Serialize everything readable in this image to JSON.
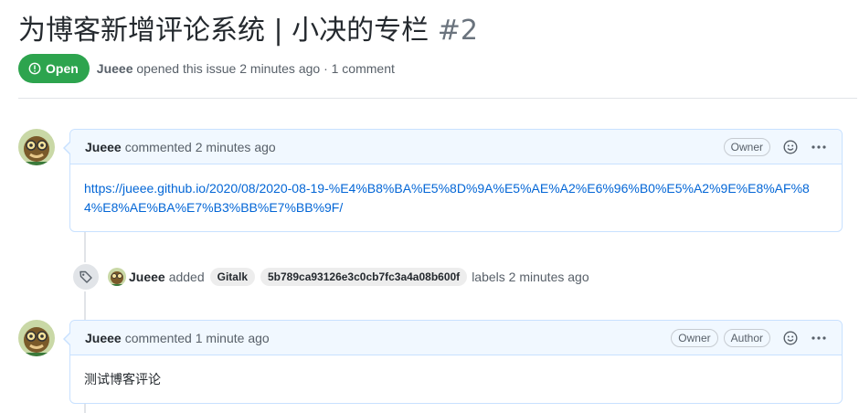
{
  "issue": {
    "title": "为博客新增评论系统 | 小决的专栏",
    "number": "#2",
    "state": "Open",
    "author": "Jueee",
    "meta": "opened this issue 2 minutes ago · 1 comment"
  },
  "comments": [
    {
      "author": "Jueee",
      "action": "commented 2 minutes ago",
      "roles": [
        "Owner"
      ],
      "body": "https://jueee.github.io/2020/08/2020-08-19-%E4%B8%BA%E5%8D%9A%E5%AE%A2%E6%96%B0%E5%A2%9E%E8%AF%84%E8%AE%BA%E7%B3%BB%E7%BB%9F/"
    },
    {
      "author": "Jueee",
      "action": "commented 1 minute ago",
      "roles": [
        "Owner",
        "Author"
      ],
      "body": "测试博客评论"
    }
  ],
  "label_event": {
    "author": "Jueee",
    "action": "added",
    "labels": [
      "Gitalk",
      "5b789ca93126e3c0cb7fc3a4a08b600f"
    ],
    "tail": "labels 2 minutes ago"
  },
  "icons": {
    "state": "issue-opened-icon",
    "event": "tag-icon",
    "reaction": "smiley-icon",
    "more": "kebab-horizontal-icon"
  },
  "colors": {
    "open_green": "#2da44e",
    "link_blue": "#0366d6",
    "header_bg": "#f1f8ff",
    "border_blue": "#c8e1ff"
  }
}
